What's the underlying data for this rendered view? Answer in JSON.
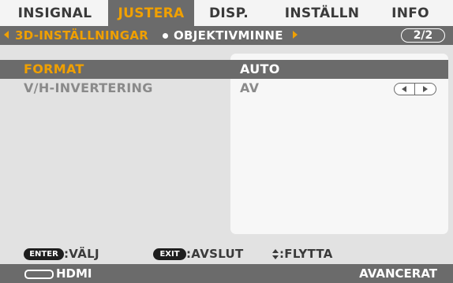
{
  "tabs": [
    {
      "label": "INSIGNAL",
      "active": false
    },
    {
      "label": "JUSTERA",
      "active": true
    },
    {
      "label": "DISP.",
      "active": false
    },
    {
      "label": "INSTÄLLN",
      "active": false
    },
    {
      "label": "INFO",
      "active": false
    }
  ],
  "subnav": {
    "current": "3D-INSTÄLLNINGAR",
    "next": "OBJEKTIVMINNE",
    "page": "2/2"
  },
  "settings": [
    {
      "label": "FORMAT",
      "value": "AUTO",
      "selected": true,
      "control": "none"
    },
    {
      "label": "V/H-INVERTERING",
      "value": "AV",
      "selected": false,
      "control": "left-right-stepper"
    }
  ],
  "help": {
    "enter_key": "ENTER",
    "enter_action": ":VÄLJ",
    "exit_key": "EXIT",
    "exit_action": ":AVSLUT",
    "move_action": ":FLYTTA"
  },
  "status": {
    "source_icon": "hdmi-connector-icon",
    "source": "HDMI",
    "mode": "AVANCERAT"
  },
  "colors": {
    "accent": "#f0a000",
    "bar": "#6b6b6b",
    "background": "#e2e2e2",
    "panel": "#f7f7f7"
  }
}
